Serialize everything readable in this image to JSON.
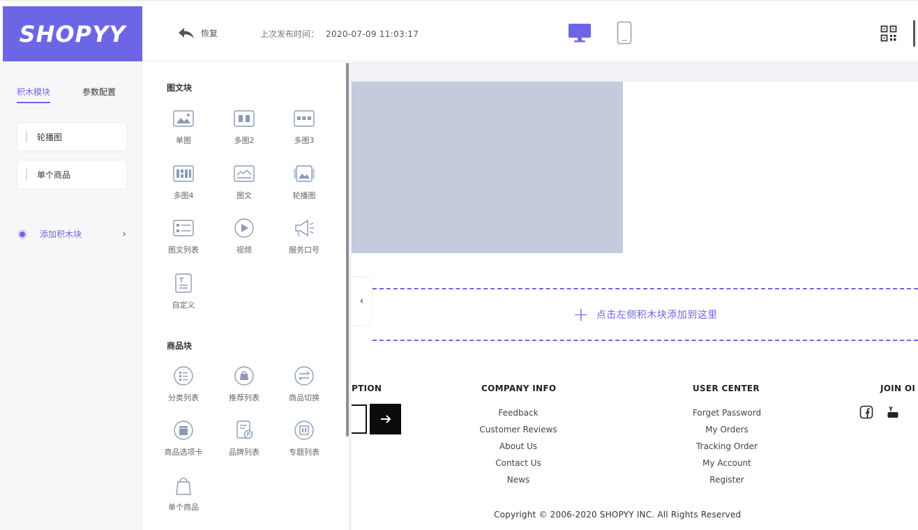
{
  "header": {
    "logo_text": "SHOPYY",
    "undo_label": "恢复",
    "publish_label": "上次发布时间：",
    "publish_time": "2020-07-09 11:03:17",
    "brand_color": "#6c66e6"
  },
  "sidebar": {
    "tabs": [
      {
        "label": "积木模块",
        "active": true
      },
      {
        "label": "参数配置",
        "active": false
      }
    ],
    "blocks": [
      {
        "label": "轮播图"
      },
      {
        "label": "单个商品"
      }
    ],
    "add_block_label": "添加积木块"
  },
  "palette": {
    "sections": [
      {
        "title": "图文块",
        "items": [
          {
            "label": "单图",
            "icon": "single-image-icon"
          },
          {
            "label": "多图2",
            "icon": "multi-image-2-icon"
          },
          {
            "label": "多图3",
            "icon": "multi-image-3-icon"
          },
          {
            "label": "多图4",
            "icon": "multi-image-4-icon"
          },
          {
            "label": "图文",
            "icon": "image-text-icon"
          },
          {
            "label": "轮播图",
            "icon": "carousel-icon"
          },
          {
            "label": "图文列表",
            "icon": "image-text-list-icon"
          },
          {
            "label": "视频",
            "icon": "video-icon"
          },
          {
            "label": "服务口号",
            "icon": "megaphone-icon"
          },
          {
            "label": "自定义",
            "icon": "custom-icon"
          }
        ]
      },
      {
        "title": "商品块",
        "items": [
          {
            "label": "分类列表",
            "icon": "category-list-icon"
          },
          {
            "label": "推荐列表",
            "icon": "recommend-list-icon"
          },
          {
            "label": "商品切换",
            "icon": "product-switch-icon"
          },
          {
            "label": "商品选项卡",
            "icon": "product-tabs-icon"
          },
          {
            "label": "品牌列表",
            "icon": "brand-list-icon"
          },
          {
            "label": "专题列表",
            "icon": "topic-list-icon"
          },
          {
            "label": "单个商品",
            "icon": "shopping-bag-icon"
          }
        ]
      }
    ]
  },
  "canvas": {
    "dropzone_label": "点击左侧积木块添加到这里",
    "footer": {
      "subscription_partial": "PTION",
      "company_info": {
        "title": "COMPANY INFO",
        "links": [
          "Feedback",
          "Customer Reviews",
          "About Us",
          "Contact Us",
          "News"
        ]
      },
      "user_center": {
        "title": "USER CENTER",
        "links": [
          "Forget Password",
          "My Orders",
          "Tracking Order",
          "My Account",
          "Register"
        ]
      },
      "join_partial": "JOIN OI",
      "copyright": "Copyright © 2006-2020 SHOPYY INC. All Rights Reserved"
    }
  }
}
